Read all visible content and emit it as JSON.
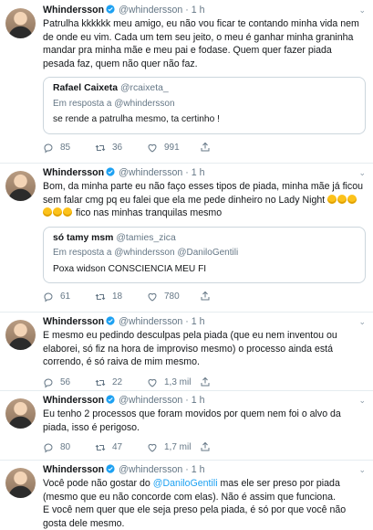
{
  "tweets": [
    {
      "name": "Whindersson",
      "handle": "@whindersson",
      "dot": "·",
      "time": "1 h",
      "text": "Patrulha kkkkkk meu amigo, eu não vou ficar te contando minha vida nem de onde eu vim. Cada um tem seu jeito, o meu é ganhar minha graninha mandar pra minha mãe e meu pai e fodase. Quem quer fazer piada pesada faz, quem não quer não faz.",
      "quote": {
        "name": "Rafael Caixeta",
        "handle": "@rcaixeta_",
        "reply_prefix": "Em resposta a ",
        "reply_to": "@whindersson",
        "text": "se rende a patrulha mesmo, ta certinho !"
      },
      "replies": "85",
      "retweets": "36",
      "likes": "991"
    },
    {
      "name": "Whindersson",
      "handle": "@whindersson",
      "dot": "·",
      "time": "1 h",
      "text": "Bom, da minha parte eu não faço esses tipos de piada, minha mãe já ficou sem falar cmg pq eu falei que ela me pede dinheiro no Lady Night",
      "text_after_emoji": "fico nas minhas tranquilas mesmo",
      "emoji_name": "laughing-crying-emoji",
      "emoji_count": 6,
      "quote": {
        "name": "só tamy msm",
        "handle": "@tamies_zica",
        "reply_prefix": "Em resposta a ",
        "reply_to": "@whindersson @DaniloGentili",
        "text": "Poxa widson CONSCIENCIA MEU FI"
      },
      "replies": "61",
      "retweets": "18",
      "likes": "780"
    },
    {
      "name": "Whindersson",
      "handle": "@whindersson",
      "dot": "·",
      "time": "1 h",
      "text": "E mesmo eu pedindo desculpas pela piada (que eu nem inventou ou elaborei, só fiz na hora de improviso mesmo) o processo ainda está correndo, é só raiva de mim mesmo.",
      "replies": "56",
      "retweets": "22",
      "likes": "1,3 mil"
    },
    {
      "name": "Whindersson",
      "handle": "@whindersson",
      "dot": "·",
      "time": "1 h",
      "text": "Eu tenho 2 processos que foram movidos por quem nem foi o alvo da piada, isso é perigoso.",
      "replies": "80",
      "retweets": "47",
      "likes": "1,7 mil"
    },
    {
      "name": "Whindersson",
      "handle": "@whindersson",
      "dot": "·",
      "time": "1 h",
      "text_before_link": "Você pode não gostar do ",
      "link": "@DaniloGentili",
      "text_after_link": " mas ele ser preso por piada (mesmo que eu não concorde com elas). Não é assim que funciona.\nE você nem quer que ele seja preso pela piada, é só por que você não gosta dele mesmo."
    }
  ],
  "colors": {
    "muted": "#657786",
    "link": "#1da1f2",
    "verified": "#1da1f2",
    "border": "#e6ecf0"
  }
}
